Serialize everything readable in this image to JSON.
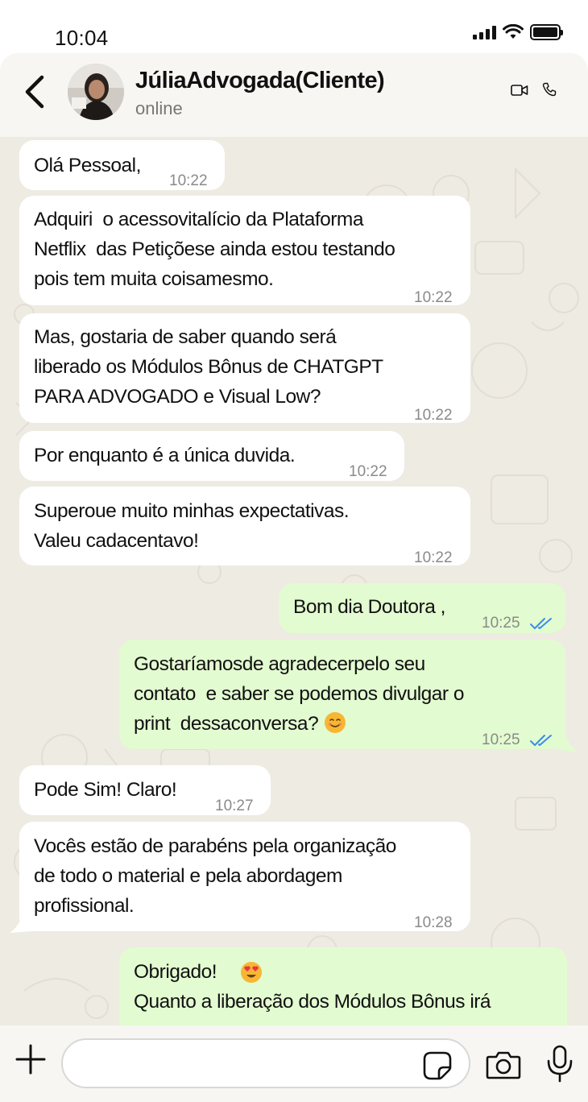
{
  "status_bar": {
    "time": "10:04"
  },
  "header": {
    "contact_name": "JúliaAdvogada(Cliente)",
    "contact_status": "online",
    "icons": [
      "back-chevron-icon",
      "video-call-icon",
      "voice-call-icon"
    ]
  },
  "messages": [
    {
      "direction": "in",
      "text": "Olá Pessoal,",
      "time": "10:22"
    },
    {
      "direction": "in",
      "text": "Adquiri  o acessovitalício da Plataforma\nNetflix  das Petiçõese ainda estou testando\npois tem muita coisamesmo.",
      "time": "10:22"
    },
    {
      "direction": "in",
      "text": "Mas, gostaria de saber quando será\nliberado os Módulos Bônus de CHATGPT\nPARA ADVOGADO e Visual Low?",
      "time": "10:22"
    },
    {
      "direction": "in",
      "text": "Por enquanto é a única duvida.",
      "time": "10:22"
    },
    {
      "direction": "in",
      "text": "Superoue muito minhas expectativas.\nValeu cadacentavo!",
      "time": "10:22"
    },
    {
      "direction": "out",
      "text": "Bom dia Doutora ,",
      "time": "10:25"
    },
    {
      "direction": "out",
      "text": "Gostaríamosde agradecerpelo seu\ncontato  e saber se podemos divulgar o\nprint  dessaconversa?",
      "time": "10:25"
    },
    {
      "direction": "in",
      "text": "Pode Sim! Claro!",
      "time": "10:27"
    },
    {
      "direction": "in",
      "text": "Vocês estão de parabéns pela organização\nde todo o material e pela abordagem\nprofissional.",
      "time": "10:28"
    },
    {
      "direction": "out",
      "text": "Obrigado!\nQuanto a liberação dos Módulos Bônus irá",
      "time": ""
    }
  ],
  "input_bar": {
    "placeholder": "",
    "icons": [
      "plus-icon",
      "sticker-icon",
      "camera-icon",
      "microphone-icon"
    ]
  },
  "colors": {
    "incoming_bubble": "#ffffff",
    "outgoing_bubble": "#e2fbd0",
    "chat_background": "#eeebe3",
    "read_ticks": "#3b8de8"
  }
}
